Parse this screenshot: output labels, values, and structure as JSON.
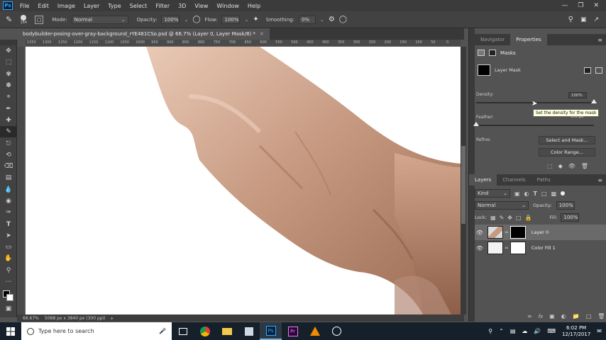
{
  "app": {
    "logo": "Ps",
    "menu": [
      "File",
      "Edit",
      "Image",
      "Layer",
      "Type",
      "Select",
      "Filter",
      "3D",
      "View",
      "Window",
      "Help"
    ]
  },
  "options": {
    "brush_size": "164",
    "mode_label": "Mode:",
    "mode_value": "Normal",
    "opacity_label": "Opacity:",
    "opacity_value": "100%",
    "flow_label": "Flow:",
    "flow_value": "100%",
    "smoothing_label": "Smoothing:",
    "smoothing_value": "0%"
  },
  "document": {
    "tab_title": "bodybuilder-posing-over-gray-background_rYE461CSo.psd @ 66.7% (Layer 0, Layer Mask/8) *",
    "zoom": "66.67%",
    "doc_size": "5088 px x 3840 px (300 ppi)"
  },
  "ruler_ticks": [
    "1350",
    "1300",
    "1250",
    "1200",
    "1150",
    "1100",
    "1050",
    "1000",
    "950",
    "900",
    "850",
    "800",
    "750",
    "700",
    "650",
    "600",
    "550",
    "500",
    "450",
    "400",
    "350",
    "300",
    "250",
    "200",
    "150",
    "100",
    "50",
    "0"
  ],
  "properties": {
    "tabs": [
      "Navigator",
      "Properties"
    ],
    "active_tab": "Properties",
    "section": "Masks",
    "mask_label": "Layer Mask",
    "density_label": "Density:",
    "density_value": "100%",
    "density_level": 1.0,
    "feather_label": "Feather:",
    "feather_value": "0.0 px",
    "feather_level": 0.0,
    "refine_label": "Refine:",
    "select_mask_btn": "Select and Mask...",
    "color_range_btn": "Color Range...",
    "tooltip": "Set the density for the mask"
  },
  "layers_panel": {
    "tabs": [
      "Layers",
      "Channels",
      "Paths"
    ],
    "active_tab": "Layers",
    "kind_label": "Kind",
    "blend_mode": "Normal",
    "opacity_label": "Opacity:",
    "opacity_value": "100%",
    "lock_label": "Lock:",
    "fill_label": "Fill:",
    "fill_value": "100%",
    "layers": [
      {
        "name": "Layer 0",
        "selected": true
      },
      {
        "name": "Color Fill 1",
        "selected": false
      }
    ]
  },
  "taskbar": {
    "search_placeholder": "Type here to search",
    "time": "6:02 PM",
    "date": "12/17/2017"
  },
  "colors": {
    "accent": "#31a8ff",
    "panel_bg": "#535353",
    "taskbar_bg": "#16202b"
  }
}
